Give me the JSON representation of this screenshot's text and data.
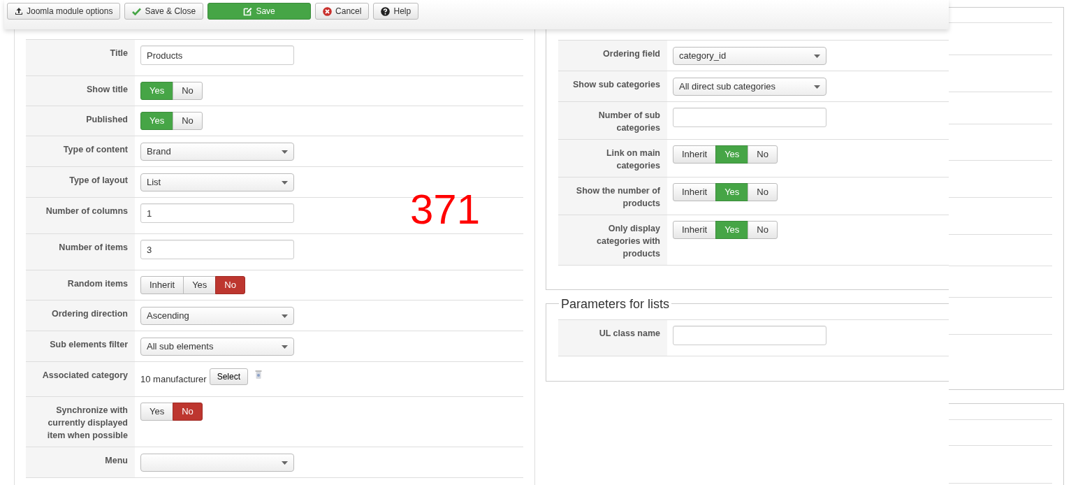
{
  "toolbar": [
    {
      "label": "Joomla module options",
      "kind": "default"
    },
    {
      "label": "Save & Close",
      "kind": "default"
    },
    {
      "label": "Save",
      "kind": "success"
    },
    {
      "label": "Cancel",
      "kind": "default"
    },
    {
      "label": "Help",
      "kind": "default"
    }
  ],
  "left_form": {
    "rows": [
      {
        "label": "Title",
        "kind": "text",
        "value": "Products"
      },
      {
        "label": "Show title",
        "kind": "toggle",
        "options": [
          {
            "label": "Yes",
            "kind": "yes",
            "selected": true
          },
          {
            "label": "No",
            "kind": "no",
            "selected": false
          }
        ]
      },
      {
        "label": "Published",
        "kind": "toggle",
        "options": [
          {
            "label": "Yes",
            "kind": "yes",
            "selected": true
          },
          {
            "label": "No",
            "kind": "no",
            "selected": false
          }
        ]
      },
      {
        "label": "Type of content",
        "kind": "select",
        "value": "Brand"
      },
      {
        "label": "Type of layout",
        "kind": "select",
        "value": "List"
      },
      {
        "label": "Number of columns",
        "kind": "text",
        "value": "1"
      },
      {
        "label": "Number of items",
        "kind": "text",
        "value": "3"
      },
      {
        "label": "Random items",
        "kind": "toggle",
        "options": [
          {
            "label": "Inherit",
            "kind": "inherit",
            "selected": false
          },
          {
            "label": "Yes",
            "kind": "yes",
            "selected": false
          },
          {
            "label": "No",
            "kind": "no",
            "selected": true
          }
        ]
      },
      {
        "label": "Ordering direction",
        "kind": "select",
        "value": "Ascending"
      },
      {
        "label": "Sub elements filter",
        "kind": "select",
        "value": "All sub elements"
      },
      {
        "label": "Associated category",
        "kind": "category",
        "value": "10 manufacturer",
        "button": "Select"
      },
      {
        "label": "Synchronize with currently displayed item when possible",
        "kind": "toggle",
        "options": [
          {
            "label": "Yes",
            "kind": "yes",
            "selected": false
          },
          {
            "label": "No",
            "kind": "no",
            "selected": true
          }
        ]
      },
      {
        "label": "Menu",
        "kind": "select"
      }
    ]
  },
  "right_form": {
    "sections": [
      {
        "rows": [
          {
            "label": "Ordering field",
            "kind": "select",
            "value": "category_id"
          },
          {
            "label": "Show sub categories",
            "kind": "select",
            "value": "All direct sub categories"
          },
          {
            "label": "Number of sub categories",
            "kind": "text"
          },
          {
            "label": "Link on main categories",
            "kind": "toggle",
            "options": [
              {
                "label": "Inherit",
                "kind": "inherit",
                "selected": false
              },
              {
                "label": "Yes",
                "kind": "yes",
                "selected": true
              },
              {
                "label": "No",
                "kind": "no",
                "selected": false
              }
            ]
          },
          {
            "label": "Show the number of products",
            "kind": "toggle",
            "options": [
              {
                "label": "Inherit",
                "kind": "inherit",
                "selected": false
              },
              {
                "label": "Yes",
                "kind": "yes",
                "selected": true
              },
              {
                "label": "No",
                "kind": "no",
                "selected": false
              }
            ]
          },
          {
            "label": "Only display categories with products",
            "kind": "toggle",
            "options": [
              {
                "label": "Inherit",
                "kind": "inherit",
                "selected": false
              },
              {
                "label": "Yes",
                "kind": "yes",
                "selected": true
              },
              {
                "label": "No",
                "kind": "no",
                "selected": false
              }
            ]
          }
        ]
      },
      {
        "legend": "Parameters for lists",
        "rows": [
          {
            "label": "UL class name",
            "kind": "text"
          }
        ]
      }
    ]
  },
  "annotation": "371"
}
